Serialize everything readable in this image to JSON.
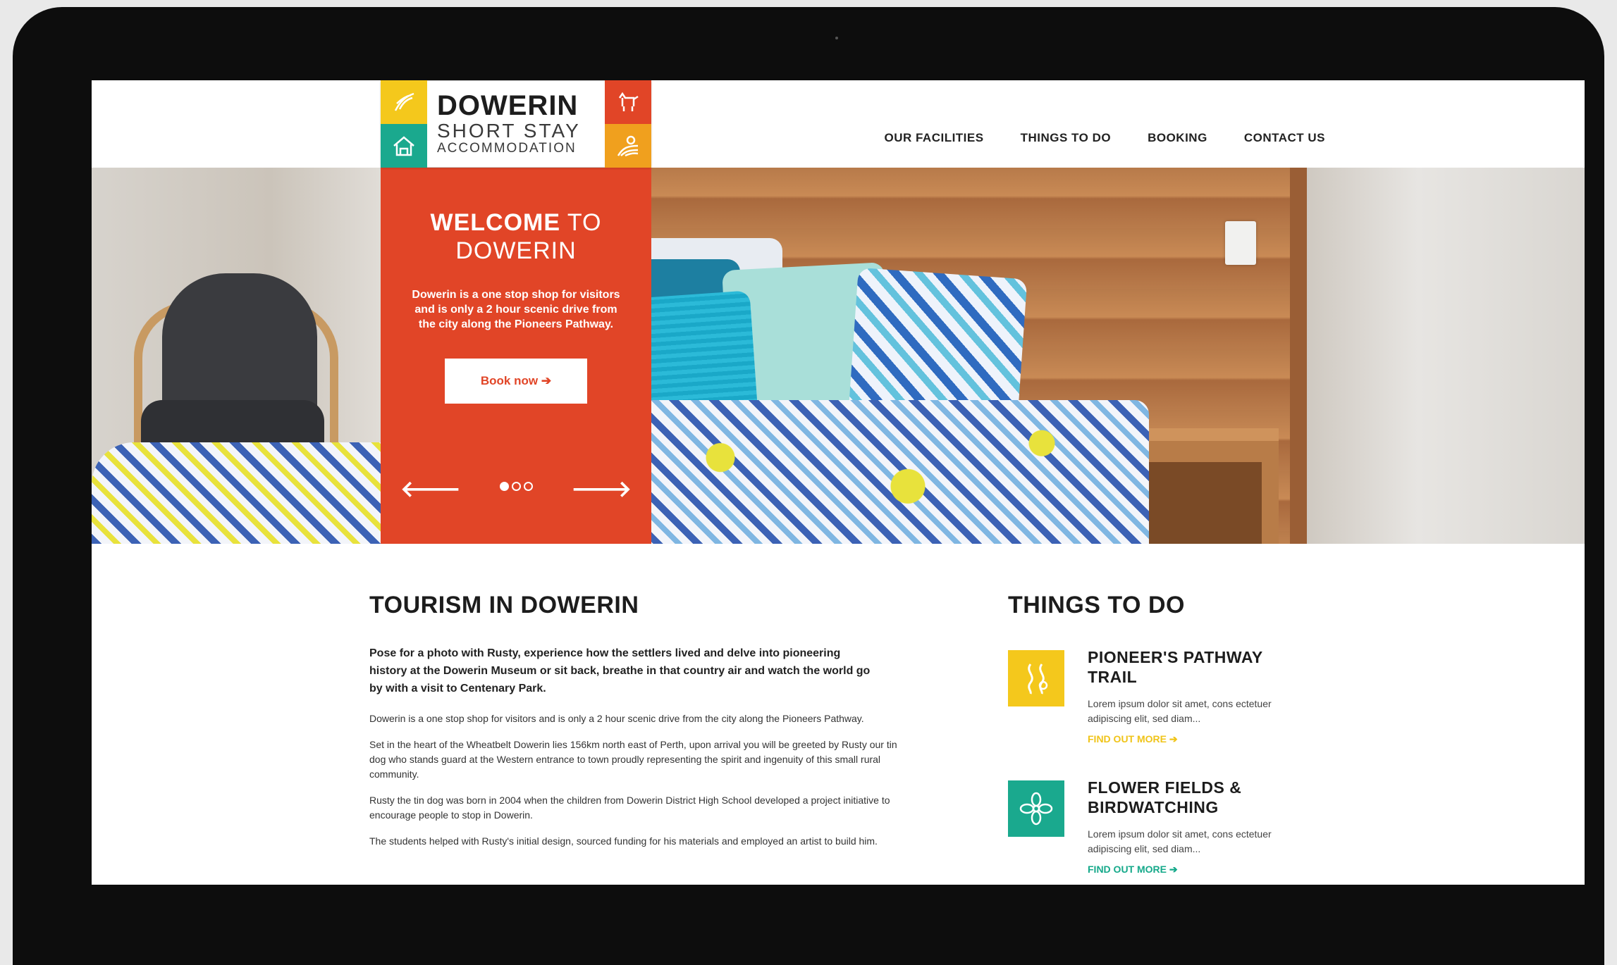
{
  "colors": {
    "accent_red": "#e14527",
    "yellow": "#f4c81c",
    "teal": "#1aa98e",
    "orange": "#f0a01e",
    "link_yellow": "#f0c419",
    "link_teal": "#15a98a"
  },
  "logo": {
    "main": "DOWERIN",
    "sub": "SHORT STAY",
    "sub2": "ACCOMMODATION",
    "icons": [
      "wheat-icon",
      "house-icon",
      "dog-icon",
      "field-icon"
    ]
  },
  "nav": {
    "items": [
      {
        "label": "OUR FACILITIES"
      },
      {
        "label": "THINGS TO DO"
      },
      {
        "label": "BOOKING"
      },
      {
        "label": "CONTACT US"
      }
    ]
  },
  "hero": {
    "welcome_bold": "WELCOME",
    "welcome_rest": " TO",
    "welcome_line2": "DOWERIN",
    "text": "Dowerin is a one stop shop for visitors and is only a 2 hour scenic drive from the city along the Pioneers Pathway.",
    "button": "Book now",
    "button_arrow": "➔",
    "arrow_left": "🡐",
    "arrow_right": "🡒",
    "slides": 3,
    "active_slide": 1
  },
  "tourism": {
    "title_bold": "TOURISM",
    "title_rest": " IN DOWERIN",
    "lead": "Pose for a photo with Rusty, experience how the settlers lived and delve into pioneering history at the Dowerin Museum or sit back, breathe in that country air and watch the world go by with a visit to Centenary Park.",
    "paragraphs": [
      "Dowerin is a one stop shop for visitors and is only a 2 hour scenic drive from the city along the Pioneers Pathway.",
      "Set in the heart of the Wheatbelt Dowerin lies 156km north east of Perth, upon arrival you will be greeted by Rusty our tin dog who stands guard at the Western entrance to town proudly representing the spirit and ingenuity of this small rural community.",
      "Rusty the tin dog was born in 2004 when the children from Dowerin District High School developed a project initiative to encourage people to stop in Dowerin.",
      "The students helped with Rusty's initial design, sourced funding for his materials and employed an artist to build him."
    ]
  },
  "things": {
    "title_bold": "THINGS",
    "title_rest": " TO DO",
    "items": [
      {
        "title": "PIONEER'S PATHWAY TRAIL",
        "text": "Lorem ipsum dolor sit amet, cons ectetuer adipiscing elit, sed diam...",
        "link": "FIND OUT MORE",
        "icon": "road-icon"
      },
      {
        "title": "FLOWER FIELDS & BIRDWATCHING",
        "text": "Lorem ipsum dolor sit amet, cons ectetuer adipiscing elit, sed diam...",
        "link": "FIND OUT MORE",
        "icon": "flower-icon"
      }
    ]
  }
}
